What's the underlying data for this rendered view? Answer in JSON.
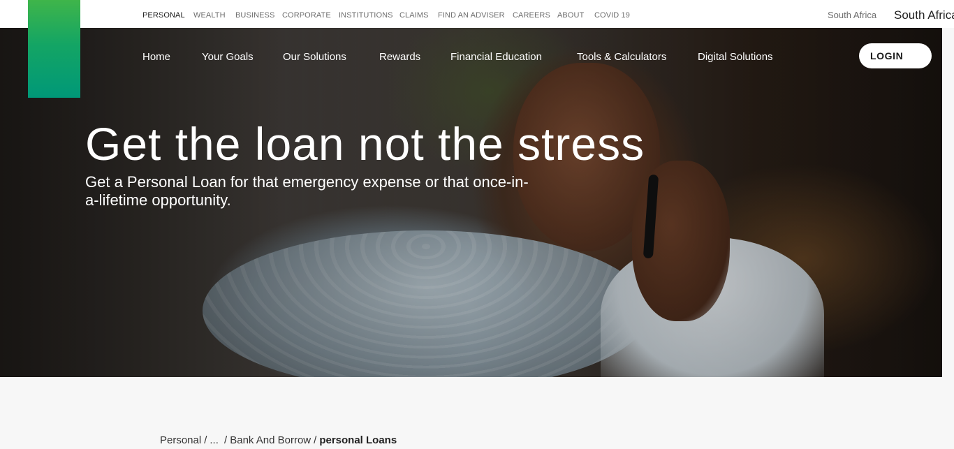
{
  "segment_nav": {
    "items": [
      {
        "label": "PERSONAL",
        "active": true
      },
      {
        "label": "WEALTH"
      },
      {
        "label": "BUSINESS"
      },
      {
        "label": "CORPORATE"
      },
      {
        "label": "INSTITUTIONS"
      },
      {
        "label": "CLAIMS"
      },
      {
        "label": "FIND AN ADVISER"
      },
      {
        "label": "CAREERS"
      },
      {
        "label": "ABOUT"
      },
      {
        "label": "COVID 19"
      }
    ]
  },
  "country": {
    "small_label": "South Africa",
    "large_label": "South Africa"
  },
  "main_nav": {
    "items": [
      {
        "label": "Home"
      },
      {
        "label": "Your Goals"
      },
      {
        "label": "Our Solutions"
      },
      {
        "label": "Rewards"
      },
      {
        "label": "Financial Education"
      },
      {
        "label": "Tools & Calculators"
      },
      {
        "label": "Digital Solutions"
      }
    ],
    "login_label": "LOGIN"
  },
  "hero": {
    "title": "Get the loan not the stress",
    "subtitle": "Get a Personal Loan for that emergency expense or that once-in-a-lifetime opportunity."
  },
  "breadcrumb": {
    "items": [
      "Personal",
      "...",
      "Bank And Borrow"
    ],
    "current": "personal Loans"
  },
  "colors": {
    "brand_green_top": "#3fb54a",
    "brand_green_bottom": "#009878"
  }
}
